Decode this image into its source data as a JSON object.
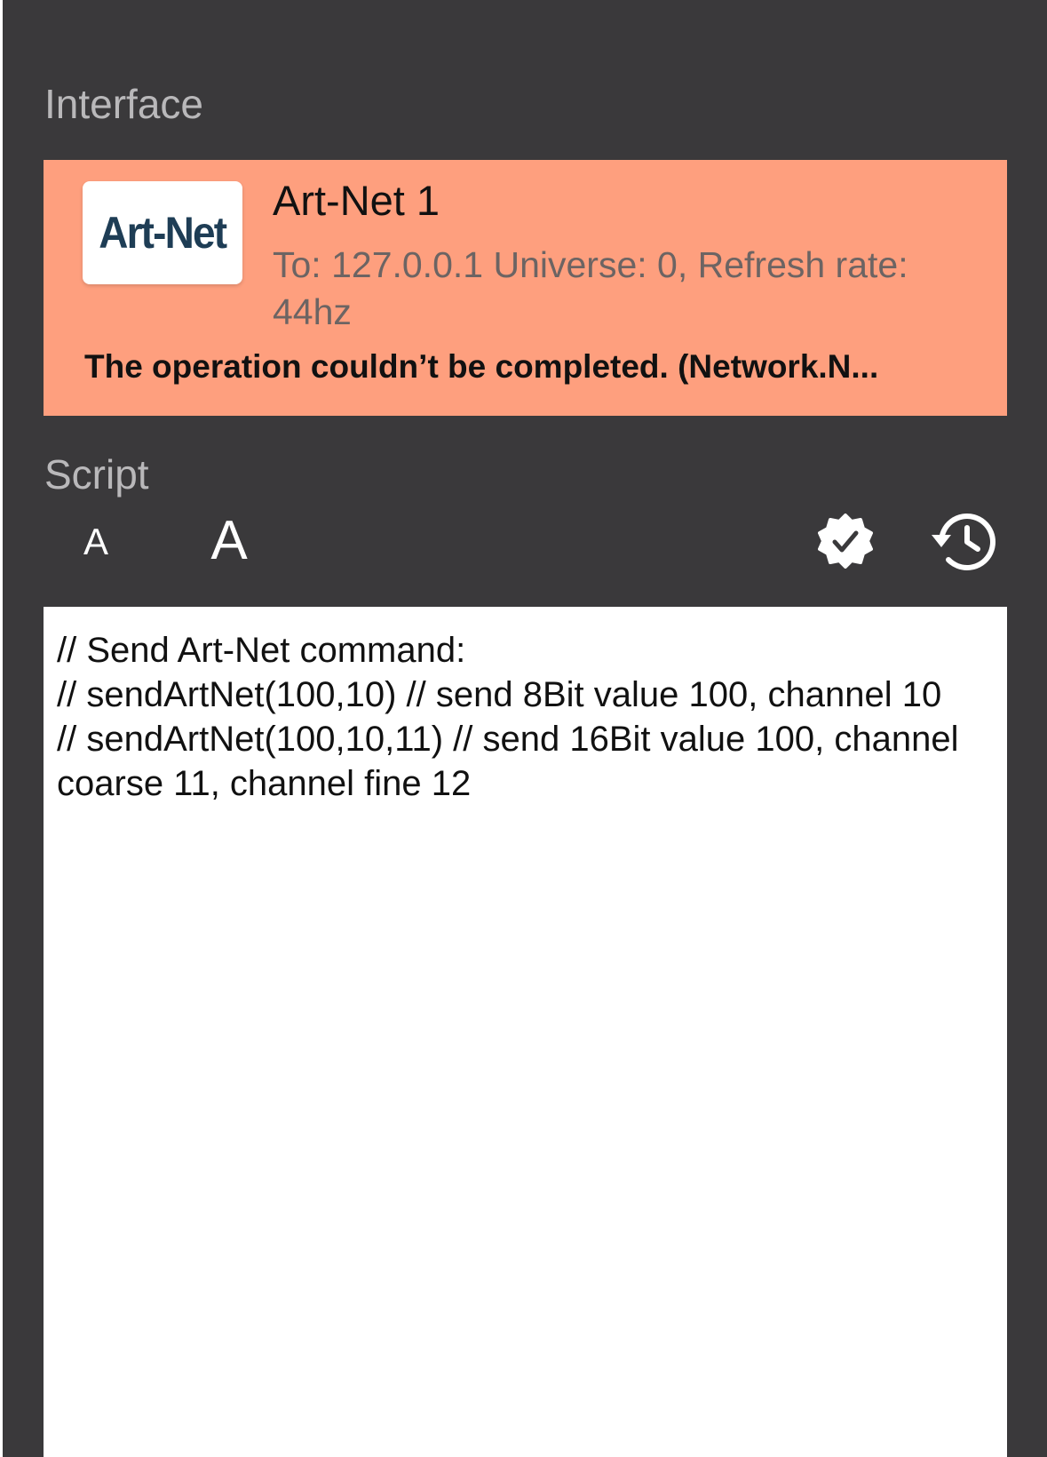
{
  "interface_section": {
    "title": "Interface",
    "card": {
      "logo_text": "Art-Net",
      "name": "Art-Net 1",
      "detail": "To: 127.0.0.1 Universe: 0, Refresh rate:  44hz",
      "error": "The operation couldn’t be completed. (Network.N...",
      "status_color": "#fe9f7e"
    }
  },
  "script_section": {
    "title": "Script",
    "toolbar": {
      "font_smaller_label": "A",
      "font_larger_label": "A",
      "validate_icon": "checkmark-seal-icon",
      "history_icon": "history-clock-icon"
    },
    "editor": {
      "content": "// Send Art-Net command:\n// sendArtNet(100,10) // send 8Bit value 100, channel 10\n// sendArtNet(100,10,11) // send 16Bit value 100, channel coarse 11, channel fine 12"
    }
  },
  "colors": {
    "panel_background": "#3a393b",
    "section_title": "#b9b8ba",
    "logo_text": "#1e3d55",
    "detail_text": "#6c6463"
  }
}
